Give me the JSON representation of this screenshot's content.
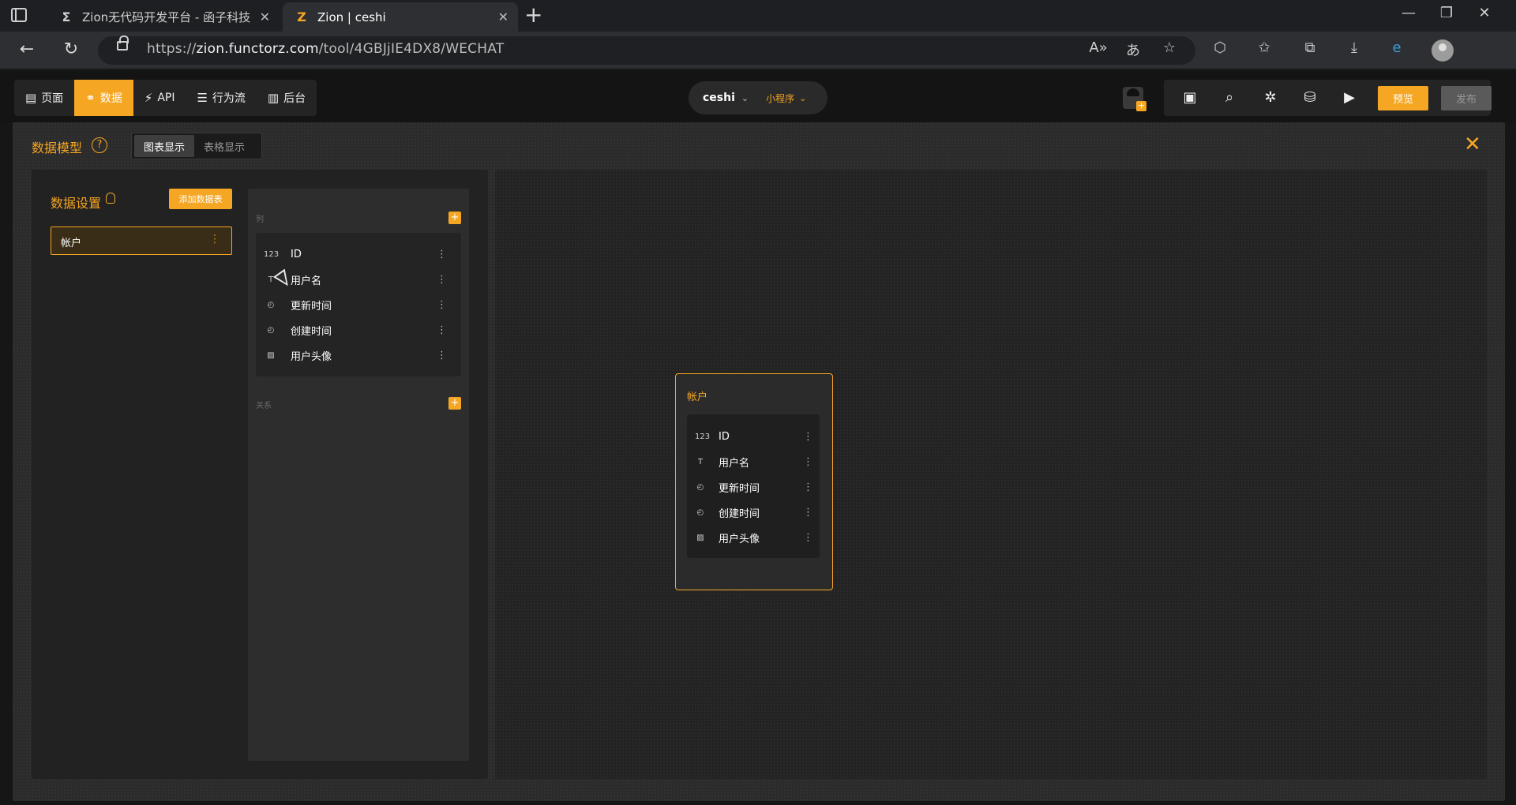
{
  "browser": {
    "tabs": [
      {
        "title": "Zion无代码开发平台 - 函子科技",
        "favicon": "sigma"
      },
      {
        "title": "Zion | ceshi",
        "favicon": "Z"
      }
    ],
    "url_prefix": "https://",
    "url_host": "zion.functorz.com",
    "url_path": "/tool/4GBJjIE4DX8/WECHAT"
  },
  "app": {
    "modes": [
      {
        "label": "页面",
        "icon": "page-icon"
      },
      {
        "label": "数据",
        "icon": "data-icon"
      },
      {
        "label": "API",
        "icon": "api-icon"
      },
      {
        "label": "行为流",
        "icon": "flow-icon"
      },
      {
        "label": "后台",
        "icon": "backend-icon"
      }
    ],
    "active_mode": "数据",
    "project_name": "ceshi",
    "project_type": "小程序",
    "preview_label": "预览",
    "publish_label": "发布",
    "accent_color": "#f5a623"
  },
  "panel": {
    "title": "数据模型",
    "view_options": [
      "图表显示",
      "表格显示"
    ],
    "active_view": "图表显示"
  },
  "settings": {
    "title": "数据设置",
    "add_table_label": "添加数据表",
    "tables": [
      {
        "name": "帐户"
      }
    ],
    "columns_label": "列",
    "relations_label": "关系"
  },
  "fields": [
    {
      "name": "ID",
      "icon": "id-icon",
      "glyph": "123"
    },
    {
      "name": "用户名",
      "icon": "text-icon",
      "glyph": "T"
    },
    {
      "name": "更新时间",
      "icon": "clock-icon",
      "glyph": "◴"
    },
    {
      "name": "创建时间",
      "icon": "clock-icon",
      "glyph": "◴"
    },
    {
      "name": "用户头像",
      "icon": "image-icon",
      "glyph": "▨"
    }
  ],
  "canvas_card": {
    "title": "帐户"
  }
}
